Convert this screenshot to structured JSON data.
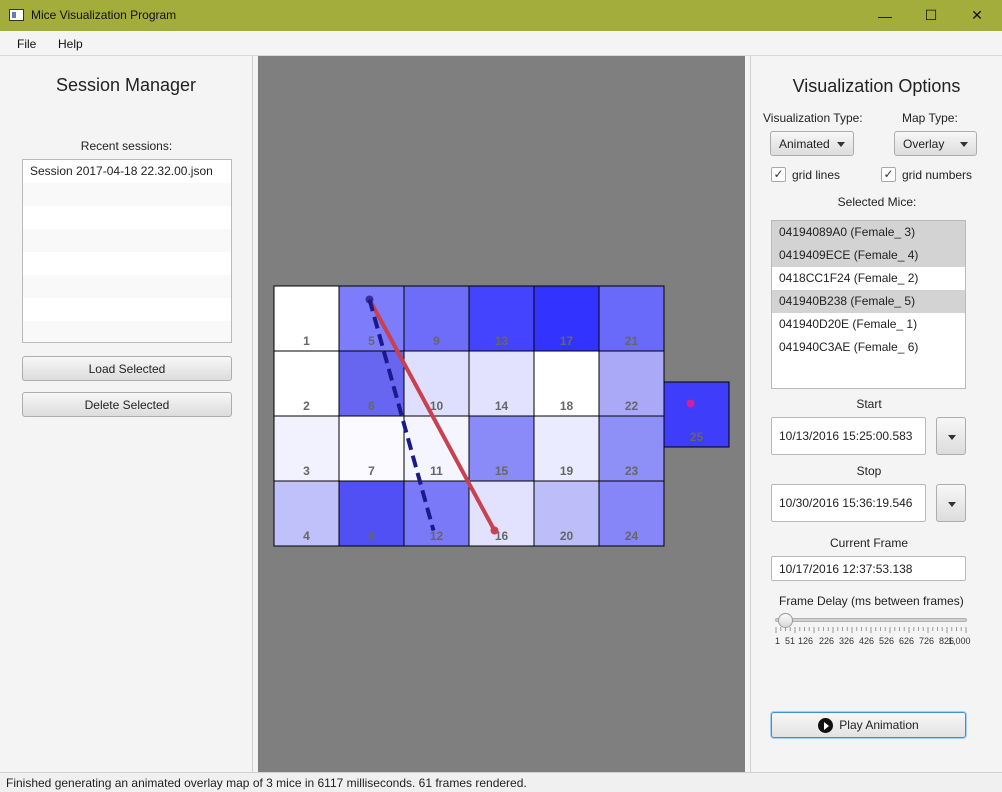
{
  "window": {
    "title": "Mice Visualization Program",
    "minimize_glyph": "—",
    "maximize_glyph": "☐",
    "close_glyph": "✕"
  },
  "menu": {
    "file": "File",
    "help": "Help"
  },
  "session_manager": {
    "title": "Session Manager",
    "recent_label": "Recent sessions:",
    "sessions": [
      "Session 2017-04-18 22.32.00.json"
    ],
    "load_button": "Load Selected",
    "delete_button": "Delete Selected"
  },
  "map": {
    "cells": [
      {
        "n": "1",
        "color": "#ffffff"
      },
      {
        "n": "2",
        "color": "#ffffff"
      },
      {
        "n": "3",
        "color": "#f2f2ff"
      },
      {
        "n": "4",
        "color": "#c0c0fa"
      },
      {
        "n": "5",
        "color": "#7d7dfc"
      },
      {
        "n": "6",
        "color": "#6666f0"
      },
      {
        "n": "7",
        "color": "#fafaff"
      },
      {
        "n": "8",
        "color": "#5050f5"
      },
      {
        "n": "9",
        "color": "#6d6dfa"
      },
      {
        "n": "10",
        "color": "#dedeff"
      },
      {
        "n": "11",
        "color": "#f5f5ff"
      },
      {
        "n": "12",
        "color": "#7a7af8"
      },
      {
        "n": "13",
        "color": "#4444ff"
      },
      {
        "n": "14",
        "color": "#e2e2ff"
      },
      {
        "n": "15",
        "color": "#8a8af8"
      },
      {
        "n": "16",
        "color": "#e2e2ff"
      },
      {
        "n": "17",
        "color": "#3333ff"
      },
      {
        "n": "18",
        "color": "#ffffff"
      },
      {
        "n": "19",
        "color": "#ebebff"
      },
      {
        "n": "20",
        "color": "#bdbdfa"
      },
      {
        "n": "21",
        "color": "#6a6afa"
      },
      {
        "n": "22",
        "color": "#a9a9f8"
      },
      {
        "n": "23",
        "color": "#8f8ff8"
      },
      {
        "n": "24",
        "color": "#8686f8"
      },
      {
        "n": "25",
        "color": "#3d3dfa"
      }
    ],
    "paths": [
      {
        "from": "5",
        "to": "16",
        "color": "#c9404f",
        "style": "solid"
      },
      {
        "from": "5",
        "to": "12",
        "color": "#1a1a8c",
        "style": "dashed"
      }
    ],
    "marker": {
      "cell": "25",
      "color": "#d020a0"
    }
  },
  "options": {
    "title": "Visualization Options",
    "vis_type_label": "Visualization Type:",
    "vis_type_value": "Animated",
    "map_type_label": "Map Type:",
    "map_type_value": "Overlay",
    "grid_lines_label": "grid lines",
    "grid_lines_checked": true,
    "grid_numbers_label": "grid numbers",
    "grid_numbers_checked": true,
    "check_glyph": "✓",
    "selected_mice_label": "Selected Mice:",
    "mice": [
      {
        "label": "04194089A0 (Female_ 3)",
        "selected": true
      },
      {
        "label": "0419409ECE (Female_ 4)",
        "selected": true
      },
      {
        "label": "0418CC1F24 (Female_ 2)",
        "selected": false
      },
      {
        "label": "041940B238 (Female_ 5)",
        "selected": true
      },
      {
        "label": "041940D20E (Female_ 1)",
        "selected": false
      },
      {
        "label": "041940C3AE (Female_ 6)",
        "selected": false
      }
    ],
    "start_label": "Start",
    "start_value": "10/13/2016 15:25:00.583",
    "stop_label": "Stop",
    "stop_value": "10/30/2016 15:36:19.546",
    "current_frame_label": "Current Frame",
    "current_frame_value": "10/17/2016 12:37:53.138",
    "frame_delay_label": "Frame Delay (ms between frames)",
    "frame_delay_value": 51,
    "slider_range": [
      1,
      1000
    ],
    "slider_tick_labels": [
      "1",
      "51",
      "126",
      "226",
      "326",
      "426",
      "526",
      "626",
      "726",
      "826",
      "1,000"
    ],
    "play_button": "Play Animation"
  },
  "status": "Finished generating an animated overlay map of 3 mice in 6117 milliseconds. 61 frames rendered."
}
